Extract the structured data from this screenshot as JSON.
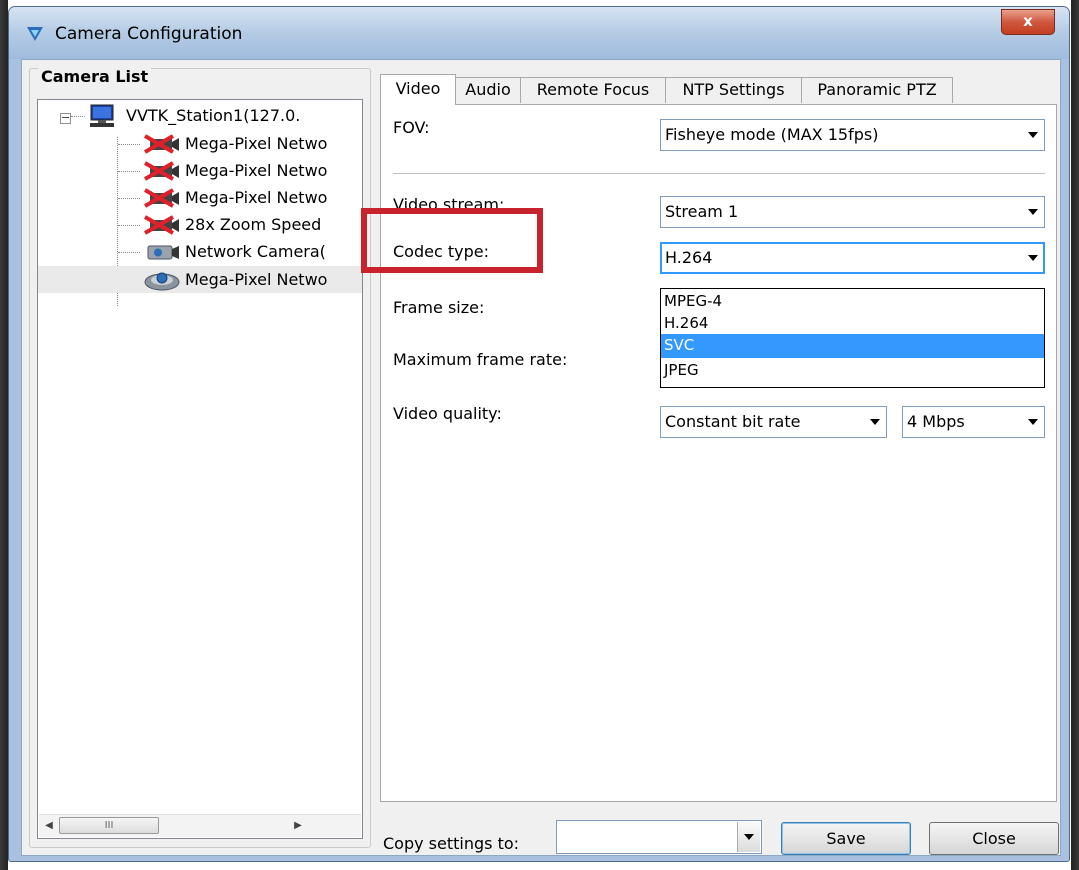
{
  "window": {
    "title": "Camera Configuration",
    "close_glyph": "x"
  },
  "camera_list": {
    "label": "Camera List",
    "items": [
      {
        "label": "VVTK_Station1(127.0.",
        "icon": "monitor-icon",
        "level": 0
      },
      {
        "label": "Mega-Pixel Netwo",
        "icon": "camera-offline-icon",
        "level": 1
      },
      {
        "label": "Mega-Pixel Netwo",
        "icon": "camera-offline-icon",
        "level": 1
      },
      {
        "label": "Mega-Pixel Netwo",
        "icon": "camera-offline-icon",
        "level": 1
      },
      {
        "label": "28x Zoom Speed",
        "icon": "camera-offline-icon",
        "level": 1
      },
      {
        "label": "Network Camera(",
        "icon": "camera-icon",
        "level": 1
      },
      {
        "label": "Mega-Pixel Netwo",
        "icon": "fisheye-camera-icon",
        "level": 1
      }
    ],
    "scroll_thumb_glyph": "III"
  },
  "tabs": [
    "Video",
    "Audio",
    "Remote Focus",
    "NTP Settings",
    "Panoramic PTZ"
  ],
  "active_tab": "Video",
  "video": {
    "fov_label": "FOV:",
    "fov_value": "Fisheye mode (MAX 15fps)",
    "stream_label": "Video stream:",
    "stream_value": "Stream 1",
    "codec_label": "Codec type:",
    "codec_value": "H.264",
    "codec_options": [
      "MPEG-4",
      "H.264",
      "SVC",
      "JPEG"
    ],
    "codec_highlighted_option": "SVC",
    "frame_size_label": "Frame size:",
    "max_frame_rate_label": "Maximum frame rate:",
    "quality_label": "Video quality:",
    "quality_mode_value": "Constant bit rate",
    "bitrate_value": "4 Mbps"
  },
  "bottom": {
    "copy_label": "Copy settings to:",
    "copy_value": "",
    "save_label": "Save",
    "close_label": "Close"
  },
  "colors": {
    "highlight_box": "#c8232c",
    "selection": "#3399ff"
  }
}
